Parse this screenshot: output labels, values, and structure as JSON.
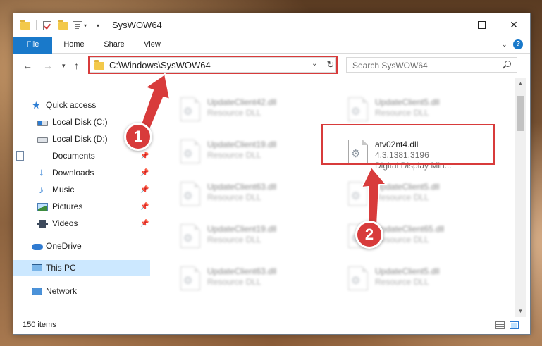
{
  "window": {
    "title": "SysWOW64",
    "controls": {
      "minimize": "",
      "maximize": "",
      "close": "✕"
    }
  },
  "ribbon": {
    "tabs": [
      "File",
      "Home",
      "Share",
      "View"
    ],
    "help": "?"
  },
  "nav": {
    "address": "C:\\Windows\\SysWOW64",
    "search_placeholder": "Search SysWOW64"
  },
  "sidebar": {
    "items": [
      {
        "label": "Quick access",
        "icon": "star-icon"
      },
      {
        "label": "Local Disk (C:)",
        "icon": "drive-icon",
        "pinned": true
      },
      {
        "label": "Local Disk (D:)",
        "icon": "drive-icon",
        "pinned": true
      },
      {
        "label": "Documents",
        "icon": "documents-icon",
        "pinned": true
      },
      {
        "label": "Downloads",
        "icon": "downloads-icon",
        "pinned": true
      },
      {
        "label": "Music",
        "icon": "music-icon",
        "pinned": true
      },
      {
        "label": "Pictures",
        "icon": "pictures-icon",
        "pinned": true
      },
      {
        "label": "Videos",
        "icon": "videos-icon",
        "pinned": true
      },
      {
        "label": "OneDrive",
        "icon": "onedrive-icon"
      },
      {
        "label": "This PC",
        "icon": "this-pc-icon",
        "selected": true
      },
      {
        "label": "Network",
        "icon": "network-icon"
      }
    ]
  },
  "files": {
    "left": [
      {
        "name": "UpdateClient42.dll",
        "type": "Resource DLL"
      },
      {
        "name": "UpdateClient19.dll",
        "type": "Resource DLL"
      },
      {
        "name": "UpdateClient63.dll",
        "type": "Resource DLL"
      },
      {
        "name": "UpdateClient19.dll",
        "type": "Resource DLL"
      },
      {
        "name": "UpdateClient63.dll",
        "type": "Resource DLL"
      }
    ],
    "right": [
      {
        "name": "UpdateClient5.dll",
        "type": "Resource DLL"
      },
      {
        "name": "atv02nt4.dll",
        "version": "4.3.1381.3196",
        "type": "Digital Display Min..."
      },
      {
        "name": "UpdateClient5.dll",
        "type": "Resource DLL"
      },
      {
        "name": "UpdateClient65.dll",
        "type": "Resource DLL"
      },
      {
        "name": "UpdateClient5.dll",
        "type": "Resource DLL"
      }
    ]
  },
  "status": {
    "count": "150 items"
  },
  "annotations": {
    "badge1": "1",
    "badge2": "2",
    "color": "#d83b3b"
  }
}
